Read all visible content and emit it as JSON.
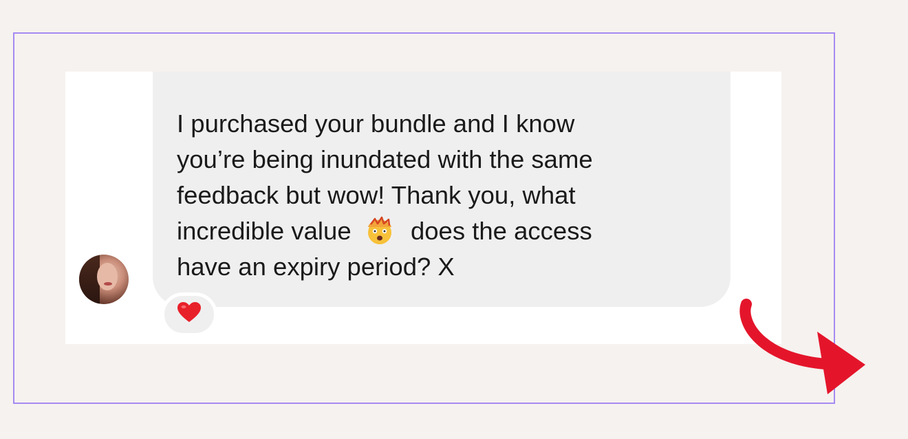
{
  "message": {
    "line_1": "I purchased your bundle and I know",
    "line_2": "you’re being inundated with the same",
    "line_3": "feedback but wow! Thank you, what",
    "line_4_before_emoji": "incredible value",
    "line_4_after_emoji": "does the access",
    "line_5": "have an expiry period? X"
  },
  "inline_emoji": "exploding-head-emoji",
  "reaction": {
    "icon": "red-heart-icon",
    "color": "#e8202a"
  },
  "avatar": {
    "icon": "profile-photo"
  },
  "decoration": {
    "arrow_icon": "curved-arrow-icon",
    "arrow_color": "#e4152b",
    "frame_color": "#a58af2",
    "background_color": "#f6f2ef"
  }
}
